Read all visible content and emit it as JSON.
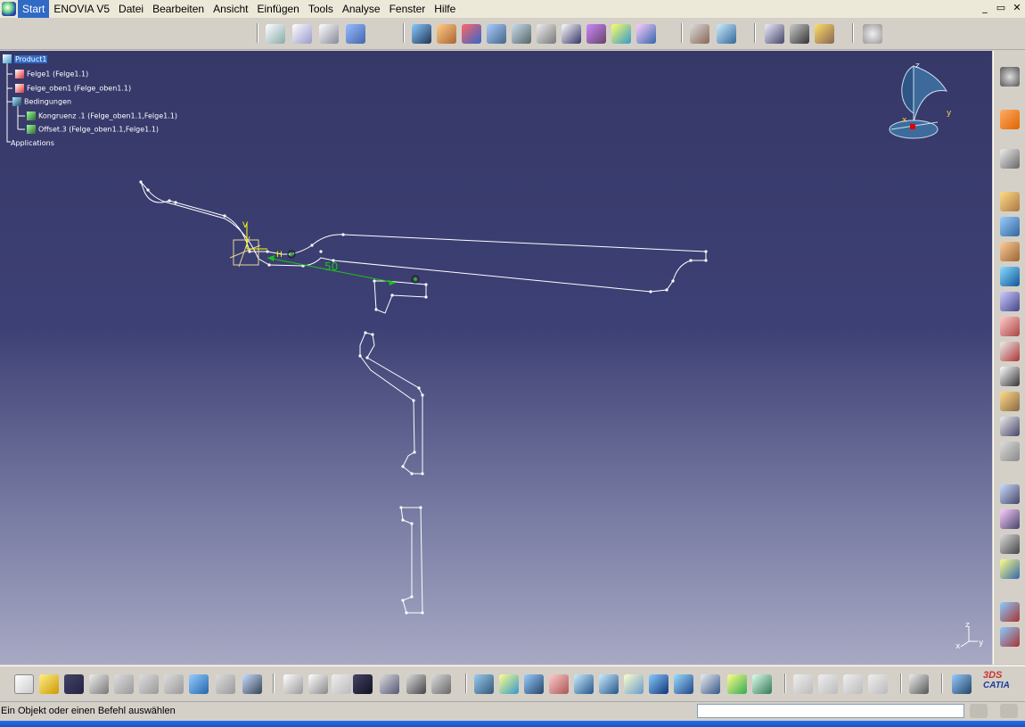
{
  "menu": {
    "items": [
      "Start",
      "ENOVIA V5",
      "Datei",
      "Bearbeiten",
      "Ansicht",
      "Einfügen",
      "Tools",
      "Analyse",
      "Fenster",
      "Hilfe"
    ]
  },
  "window_controls": {
    "minimize": "_",
    "restore": "▭",
    "close": "✕"
  },
  "tree": {
    "root": "Product1",
    "nodes": [
      {
        "label": "Felge1 (Felge1.1)",
        "icon": "part-icon"
      },
      {
        "label": "Felge_oben1 (Felge_oben1.1)",
        "icon": "part-icon"
      },
      {
        "label": "Bedingungen",
        "icon": "constraints-icon"
      },
      {
        "label": "Kongruenz .1 (Felge_oben1.1,Felge1.1)",
        "icon": "coincidence-icon"
      },
      {
        "label": "Offset.3 (Felge_oben1.1,Felge1.1)",
        "icon": "offset-icon"
      },
      {
        "label": "Applications",
        "icon": "applications-icon"
      }
    ]
  },
  "viewport": {
    "dimension_label": "50",
    "h_label": "H",
    "v_label": "V",
    "compass": {
      "x": "x",
      "y": "y",
      "z": "z"
    },
    "axis": {
      "x": "x",
      "y": "y",
      "z": "z"
    }
  },
  "status": {
    "message": "Ein Objekt oder einen Befehl auswählen",
    "command_value": ""
  },
  "brand": {
    "name": "CATIA",
    "prefix": "3DS"
  },
  "colors": {
    "accent": "#316ac5",
    "viewport_top": "#363868",
    "viewport_bottom": "#a7a9c4",
    "dimension": "#19c219"
  }
}
